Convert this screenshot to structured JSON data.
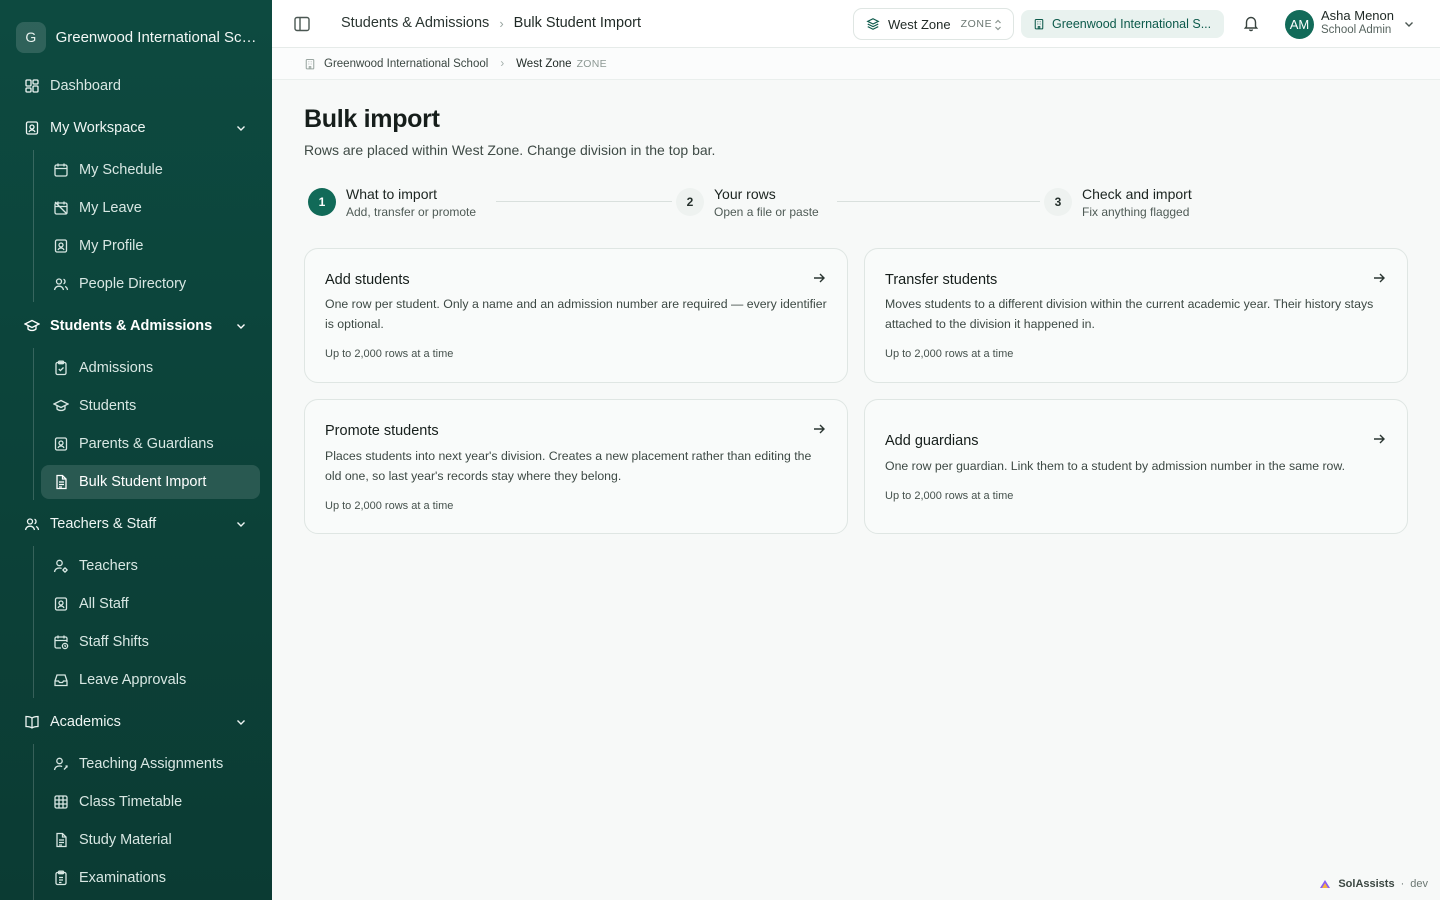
{
  "sidebar": {
    "org_initial": "G",
    "org_name": "Greenwood International School",
    "dashboard": "Dashboard",
    "groups": {
      "workspace": {
        "label": "My Workspace",
        "items": [
          "My Schedule",
          "My Leave",
          "My Profile",
          "People Directory"
        ]
      },
      "students": {
        "label": "Students & Admissions",
        "items": [
          "Admissions",
          "Students",
          "Parents & Guardians",
          "Bulk Student Import"
        ]
      },
      "staff": {
        "label": "Teachers & Staff",
        "items": [
          "Teachers",
          "All Staff",
          "Staff Shifts",
          "Leave Approvals"
        ]
      },
      "academics": {
        "label": "Academics",
        "items": [
          "Teaching Assignments",
          "Class Timetable",
          "Study Material",
          "Examinations"
        ]
      }
    }
  },
  "topbar": {
    "breadcrumb": [
      "Students & Admissions",
      "Bulk Student Import"
    ],
    "zone_name": "West Zone",
    "zone_tag": "ZONE",
    "school_name": "Greenwood International S...",
    "user_initials": "AM",
    "user_name": "Asha Menon",
    "user_role": "School Admin"
  },
  "subcrumb": {
    "school": "Greenwood International School",
    "zone": "West Zone",
    "zone_tag": "ZONE"
  },
  "page": {
    "title": "Bulk import",
    "subtitle": "Rows are placed within West Zone. Change division in the top bar."
  },
  "steps": [
    {
      "num": "1",
      "label": "What to import",
      "desc": "Add, transfer or promote"
    },
    {
      "num": "2",
      "label": "Your rows",
      "desc": "Open a file or paste"
    },
    {
      "num": "3",
      "label": "Check and import",
      "desc": "Fix anything flagged"
    }
  ],
  "cards": [
    {
      "title": "Add students",
      "desc": "One row per student. Only a name and an admission number are required — every identifier is optional.",
      "meta": "Up to 2,000 rows at a time"
    },
    {
      "title": "Transfer students",
      "desc": "Moves students to a different division within the current academic year. Their history stays attached to the division it happened in.",
      "meta": "Up to 2,000 rows at a time"
    },
    {
      "title": "Promote students",
      "desc": "Places students into next year's division. Creates a new placement rather than editing the old one, so last year's records stay where they belong.",
      "meta": "Up to 2,000 rows at a time"
    },
    {
      "title": "Add guardians",
      "desc": "One row per guardian. Link them to a student by admission number in the same row.",
      "meta": "Up to 2,000 rows at a time"
    }
  ],
  "footer": {
    "brand": "SolAssists",
    "env": "dev"
  },
  "colors": {
    "sidebar": "#0d4a40",
    "accent": "#116a58",
    "pill": "#e9f2ef"
  }
}
